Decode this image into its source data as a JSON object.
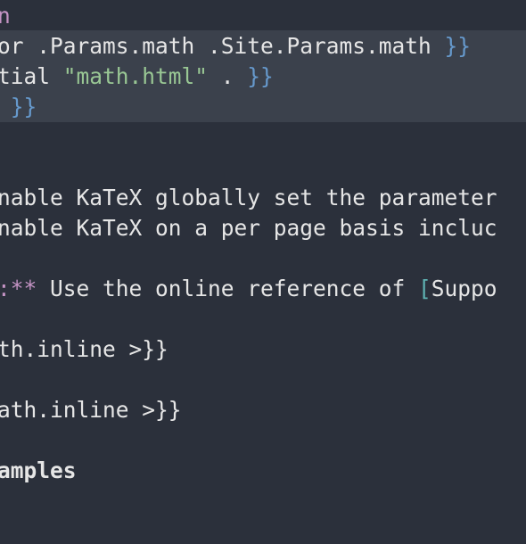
{
  "editor": {
    "lines": [
      {
        "tokens": [
          {
            "text": "n",
            "type": "keyword"
          }
        ]
      },
      {
        "tokens": [
          {
            "text": "or .Params.math .Site.Params.math ",
            "type": "plain"
          },
          {
            "text": "}}",
            "type": "brace"
          }
        ]
      },
      {
        "tokens": [
          {
            "text": "tial ",
            "type": "plain"
          },
          {
            "text": "\"math.html\"",
            "type": "string"
          },
          {
            "text": " . ",
            "type": "plain"
          },
          {
            "text": "}}",
            "type": "brace"
          }
        ]
      },
      {
        "tokens": [
          {
            "text": " }}",
            "type": "brace"
          }
        ]
      },
      {
        "tokens": []
      },
      {
        "tokens": []
      },
      {
        "tokens": [
          {
            "text": "nable KaTeX globally set the parameter",
            "type": "plain"
          }
        ]
      },
      {
        "tokens": [
          {
            "text": "nable KaTeX on a per page basis incluc",
            "type": "plain"
          }
        ]
      },
      {
        "tokens": []
      },
      {
        "tokens": [
          {
            "text": ":**",
            "type": "emph"
          },
          {
            "text": " Use the online reference of ",
            "type": "plain"
          },
          {
            "text": "[",
            "type": "link"
          },
          {
            "text": "Suppo",
            "type": "plain"
          }
        ]
      },
      {
        "tokens": []
      },
      {
        "tokens": [
          {
            "text": "th.inline >}}",
            "type": "plain"
          }
        ]
      },
      {
        "tokens": []
      },
      {
        "tokens": [
          {
            "text": "ath.inline >}}",
            "type": "plain"
          }
        ]
      },
      {
        "tokens": []
      },
      {
        "tokens": [
          {
            "text": "amples",
            "type": "bold"
          }
        ]
      }
    ]
  }
}
